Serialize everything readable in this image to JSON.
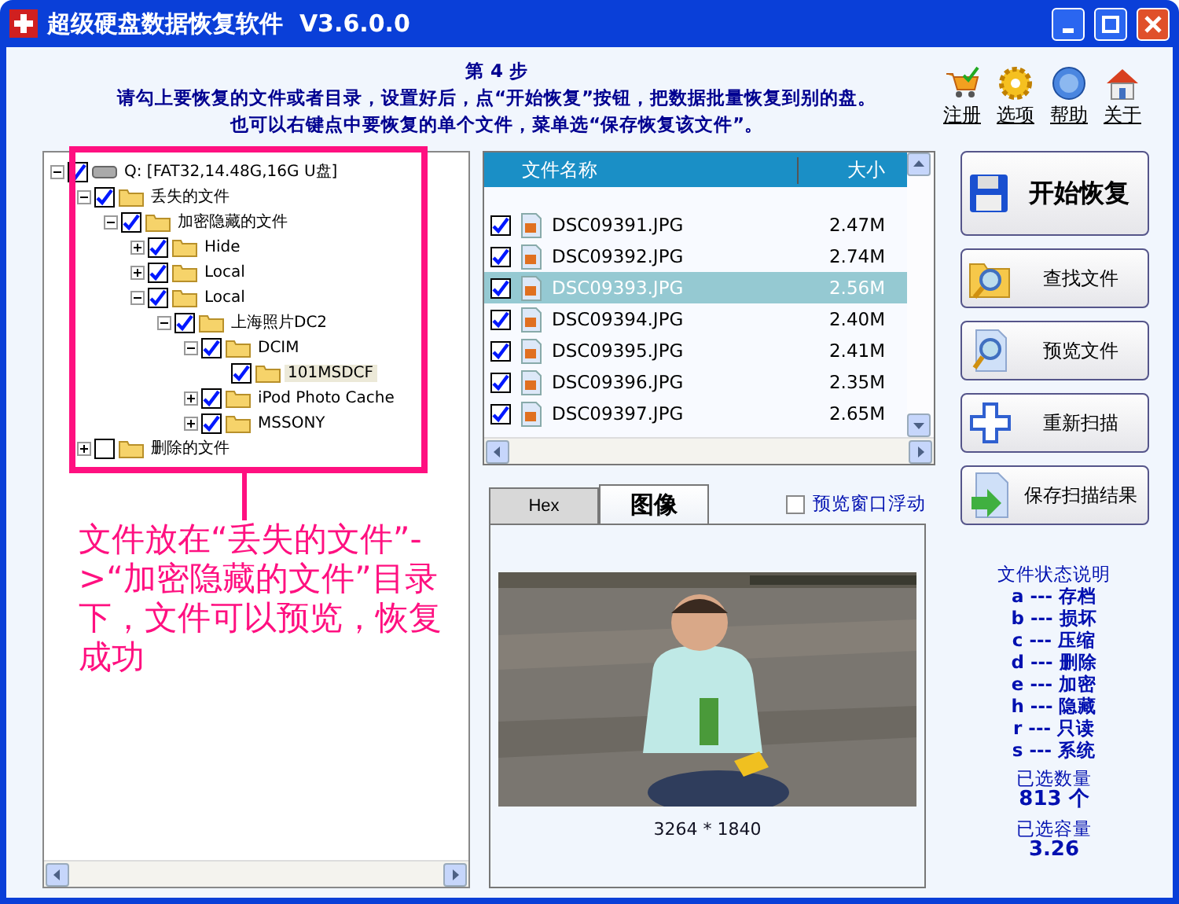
{
  "window": {
    "title": "超级硬盘数据恢复软件  V3.6.0.0"
  },
  "instructions": {
    "step": "第 4 步",
    "line_1": "请勾上要恢复的文件或者目录，设置好后，点“开始恢复”按钮，把数据批量恢复到别的盘。",
    "line_2": "也可以右键点中要恢复的单个文件，菜单选“保存恢复该文件”。"
  },
  "toolbar": [
    {
      "label": "注册",
      "kind": "cart"
    },
    {
      "label": "选项",
      "kind": "gear"
    },
    {
      "label": "帮助",
      "kind": "help"
    },
    {
      "label": "关于",
      "kind": "home"
    }
  ],
  "tree": [
    {
      "label": "Q:  [FAT32,14.48G,16G U盘]",
      "kind": "drive",
      "checked": true,
      "expanded": true,
      "selected": false,
      "children": [
        {
          "label": "丢失的文件",
          "kind": "folder",
          "checked": true,
          "expanded": true,
          "selected": false,
          "children": [
            {
              "label": "加密隐藏的文件",
              "kind": "folder",
              "checked": true,
              "expanded": true,
              "selected": false,
              "children": [
                {
                  "label": "Hide",
                  "kind": "folder",
                  "checked": true,
                  "expanded": false,
                  "selected": false
                },
                {
                  "label": "Local",
                  "kind": "folder",
                  "checked": true,
                  "expanded": false,
                  "selected": false
                },
                {
                  "label": "Local",
                  "kind": "folder",
                  "checked": true,
                  "expanded": true,
                  "selected": false,
                  "children": [
                    {
                      "label": "上海照片DC2",
                      "kind": "folder",
                      "checked": true,
                      "expanded": true,
                      "selected": false,
                      "children": [
                        {
                          "label": "DCIM",
                          "kind": "folder",
                          "checked": true,
                          "expanded": true,
                          "selected": false,
                          "children": [
                            {
                              "label": "101MSDCF",
                              "kind": "folder",
                              "checked": true,
                              "selected": true
                            }
                          ]
                        },
                        {
                          "label": "iPod Photo Cache",
                          "kind": "folder",
                          "checked": true,
                          "expanded": false,
                          "selected": false
                        },
                        {
                          "label": "MSSONY",
                          "kind": "folder",
                          "checked": true,
                          "expanded": false,
                          "selected": false
                        }
                      ]
                    }
                  ]
                }
              ]
            }
          ]
        },
        {
          "label": "删除的文件",
          "kind": "folder",
          "checked": false,
          "expanded": false,
          "selected": false
        }
      ]
    }
  ],
  "file_list": {
    "columns": [
      "文件名称",
      "大小"
    ],
    "rows": [
      {
        "name": "DSC09391.JPG",
        "size": "2.47M",
        "checked": true,
        "selected": false
      },
      {
        "name": "DSC09392.JPG",
        "size": "2.74M",
        "checked": true,
        "selected": false
      },
      {
        "name": "DSC09393.JPG",
        "size": "2.56M",
        "checked": true,
        "selected": true
      },
      {
        "name": "DSC09394.JPG",
        "size": "2.40M",
        "checked": true,
        "selected": false
      },
      {
        "name": "DSC09395.JPG",
        "size": "2.41M",
        "checked": true,
        "selected": false
      },
      {
        "name": "DSC09396.JPG",
        "size": "2.35M",
        "checked": true,
        "selected": false
      },
      {
        "name": "DSC09397.JPG",
        "size": "2.65M",
        "checked": true,
        "selected": false
      }
    ]
  },
  "preview": {
    "tabs": [
      {
        "label": "Hex",
        "selected": false
      },
      {
        "label": "图像",
        "selected": true
      }
    ],
    "float_option": {
      "label": "预览窗口浮动",
      "checked": false
    },
    "dimensions": "3264 * 1840"
  },
  "actions": [
    {
      "label": "开始恢复",
      "kind": "save"
    },
    {
      "label": "查找文件",
      "kind": "find"
    },
    {
      "label": "预览文件",
      "kind": "preview"
    },
    {
      "label": "重新扫描",
      "kind": "plus"
    },
    {
      "label": "保存扫描结果",
      "kind": "export"
    }
  ],
  "legend": {
    "title": "文件状态说明",
    "items": [
      {
        "text": "a --- 存档"
      },
      {
        "text": "b --- 损坏"
      },
      {
        "text": "c --- 压缩"
      },
      {
        "text": "d --- 删除"
      },
      {
        "text": "e --- 加密"
      },
      {
        "text": "h --- 隐藏"
      },
      {
        "text": "r --- 只读"
      },
      {
        "text": "s --- 系统"
      }
    ]
  },
  "selected_count": {
    "label": "已选数量",
    "value": "813 个"
  },
  "selected_size": {
    "label": "已选容量",
    "value": "3.26"
  },
  "annotation": {
    "text": "文件放在“丢失的文件”->“加密隐藏的文件”目录下，文件可以预览，恢复成功"
  }
}
